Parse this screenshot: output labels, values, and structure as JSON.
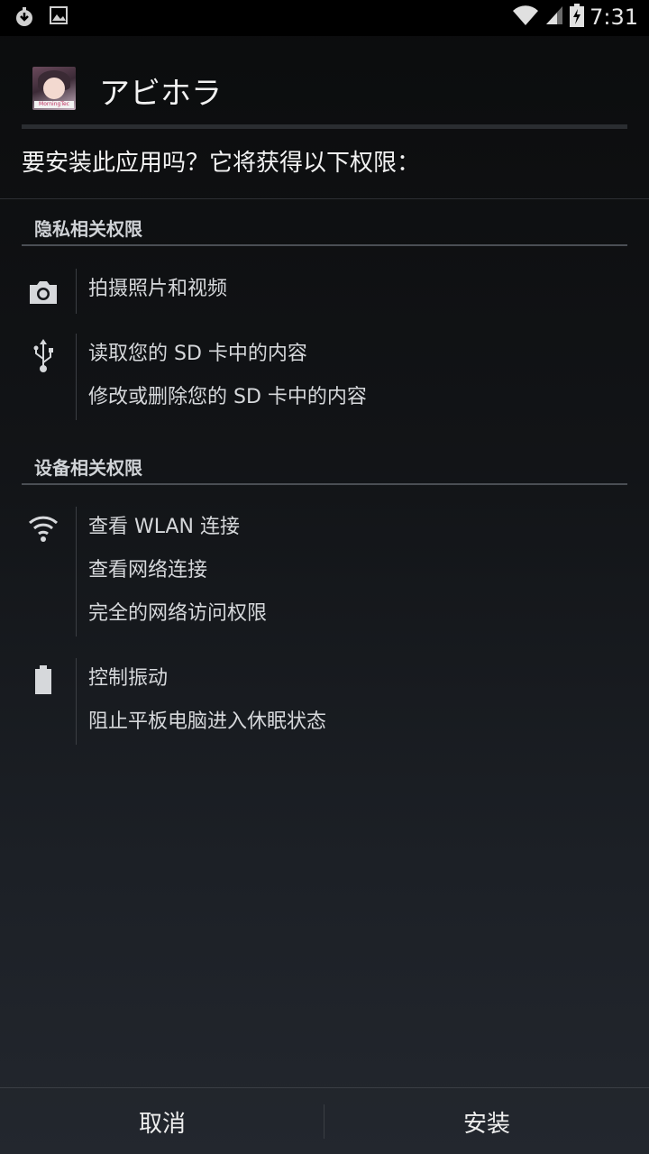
{
  "status_bar": {
    "time": "7:31",
    "left_icons": [
      "download-notification-icon",
      "image-notification-icon"
    ],
    "right_icons": [
      "wifi-signal-icon",
      "cell-signal-icon",
      "battery-charging-icon"
    ]
  },
  "app": {
    "icon_caption": "MorningTec",
    "name": "アビホラ"
  },
  "prompt": "要安装此应用吗？它将获得以下权限：",
  "sections": {
    "privacy": {
      "title": "隐私相关权限",
      "groups": {
        "camera": {
          "icon": "camera-icon",
          "items": [
            "拍摄照片和视频"
          ]
        },
        "storage": {
          "icon": "usb-icon",
          "items": [
            "读取您的 SD 卡中的内容",
            "修改或删除您的 SD 卡中的内容"
          ]
        }
      }
    },
    "device": {
      "title": "设备相关权限",
      "groups": {
        "network": {
          "icon": "wifi-icon",
          "items": [
            "查看 WLAN 连接",
            "查看网络连接",
            "完全的网络访问权限"
          ]
        },
        "power": {
          "icon": "battery-icon",
          "items": [
            "控制振动",
            "阻止平板电脑进入休眠状态"
          ]
        }
      }
    }
  },
  "buttons": {
    "cancel": "取消",
    "install": "安装"
  },
  "colors": {
    "background_top": "#0b0c0d",
    "background_bottom": "#23272e",
    "text_primary": "#f2f2f2",
    "text_secondary": "#d6d8db",
    "divider": "#4a4e54"
  }
}
